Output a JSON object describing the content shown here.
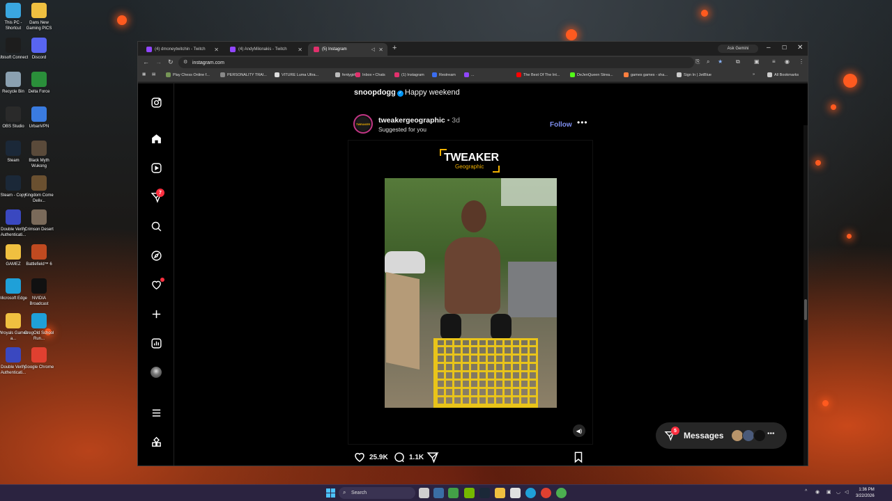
{
  "desktop": {
    "icons": [
      {
        "label": "This PC - Shortcut",
        "icon": "pc-icon",
        "color": "#3aa7e0"
      },
      {
        "label": "Dans New Gaming PICS",
        "icon": "folder-icon",
        "color": "#f0c040"
      },
      {
        "label": "Ubisoft Connect",
        "icon": "ubisoft-icon",
        "color": "#1d1d1d"
      },
      {
        "label": "Discord",
        "icon": "discord-icon",
        "color": "#5865f2"
      },
      {
        "label": "Recycle Bin",
        "icon": "recycle-bin-icon",
        "color": "#8aa0b0"
      },
      {
        "label": "Delta Force",
        "icon": "delta-force-icon",
        "color": "#2a8f3a"
      },
      {
        "label": "OBS Studio",
        "icon": "obs-icon",
        "color": "#2a2a2a"
      },
      {
        "label": "UrbanVPN",
        "icon": "vpn-icon",
        "color": "#3a7be0"
      },
      {
        "label": "Steam",
        "icon": "steam-icon",
        "color": "#1b2838"
      },
      {
        "label": "Black Myth Wukong",
        "icon": "game-icon",
        "color": "#5a4a3a"
      },
      {
        "label": "Steam - Copy",
        "icon": "steam-icon",
        "color": "#1b2838"
      },
      {
        "label": "Kingdom Come Deliv...",
        "icon": "game-icon",
        "color": "#6a5030"
      },
      {
        "label": "Double Verify Authenticati...",
        "icon": "shield-icon",
        "color": "#3a48c0"
      },
      {
        "label": "Crimson Desert",
        "icon": "game-icon",
        "color": "#7a6a5a"
      },
      {
        "label": "GAMEZ",
        "icon": "folder-icon",
        "color": "#f0c040"
      },
      {
        "label": "Battlefield™ 6",
        "icon": "game-icon",
        "color": "#c04a20"
      },
      {
        "label": "Microsoft Edge",
        "icon": "edge-icon",
        "color": "#1fa0d8"
      },
      {
        "label": "NVIDIA Broadcast",
        "icon": "nvidia-icon",
        "color": "#111111"
      },
      {
        "label": "Wroyals Games a...",
        "icon": "folder-icon",
        "color": "#f0c040"
      },
      {
        "label": "GregOld School Run...",
        "icon": "edge-icon",
        "color": "#1fa0d8"
      },
      {
        "label": "Double Verify Authenticati...",
        "icon": "shield-icon",
        "color": "#3a48c0"
      },
      {
        "label": "Google Chrome",
        "icon": "chrome-icon",
        "color": "#e04030"
      }
    ]
  },
  "browser": {
    "tabs": [
      {
        "title": "(4) dmoneytwitchin - Twitch",
        "color": "#9146ff",
        "active": false
      },
      {
        "title": "(4) AndyMilonakis - Twitch",
        "color": "#9146ff",
        "active": false
      },
      {
        "title": "(5) Instagram",
        "color": "#e1306c",
        "active": true
      }
    ],
    "new_tab": "+",
    "ask_gemini": "Ask Gemini",
    "url": "instagram.com",
    "bookmarks": [
      {
        "label": "Play Chess Online f...",
        "color": "#769656"
      },
      {
        "label": "PERSONALITY TRAI...",
        "color": "#888888"
      },
      {
        "label": "VITURE Luma Ultra...",
        "color": "#dddddd"
      },
      {
        "label": "fentygirl",
        "color": "#bbbbbb"
      },
      {
        "label": "Inbox • Chats",
        "color": "#e1306c"
      },
      {
        "label": "(1) Instagram",
        "color": "#e1306c"
      },
      {
        "label": "Restream",
        "color": "#3a6df0"
      },
      {
        "label": "...",
        "color": "#9146ff"
      },
      {
        "label": "The Best Of The Int...",
        "color": "#ff0000"
      },
      {
        "label": "DeJenQueen Strea...",
        "color": "#53fc18"
      },
      {
        "label": "games games - sha...",
        "color": "#ff7f3f"
      },
      {
        "label": "Sign In | JetBlue",
        "color": "#cccccc"
      },
      {
        "label": "All Bookmarks",
        "color": "#cccccc"
      }
    ]
  },
  "instagram": {
    "nav": {
      "notifications_badge": "7"
    },
    "previous_post": {
      "username": "snoopdogg",
      "caption": "Happy weekend"
    },
    "post": {
      "username": "tweakergeographic",
      "separator": "•",
      "time": "3d",
      "subtitle": "Suggested for you",
      "follow_label": "Follow",
      "more": "•••",
      "avatar_text": "TWEAKER",
      "brand_title": "TWEAKER",
      "brand_subtitle": "Geographic",
      "likes": "25.9K",
      "comments": "1.1K"
    },
    "messages": {
      "label": "Messages",
      "badge": "5",
      "more": "•••"
    }
  },
  "taskbar": {
    "search_placeholder": "Search",
    "time": "1:36 PM",
    "date": "3/22/2026"
  }
}
